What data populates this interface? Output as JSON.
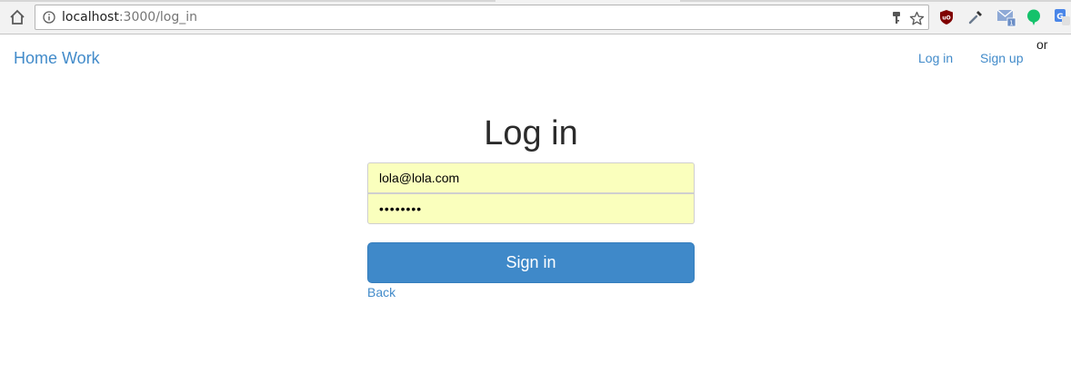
{
  "browser": {
    "url_host": "localhost",
    "url_path": ":3000/log_in",
    "icons": [
      "home-icon",
      "info-icon",
      "key-icon",
      "star-icon",
      "ublock-icon",
      "eyedropper-icon",
      "mail-icon",
      "green-circle-icon",
      "translate-icon"
    ],
    "mail_badge": "1"
  },
  "navbar": {
    "brand": "Home Work",
    "login_label": "Log in",
    "signup_label": "Sign up",
    "or_text": "or"
  },
  "form": {
    "title": "Log in",
    "email_value": "lola@lola.com",
    "password_value": "••••••••",
    "submit_label": "Sign in",
    "back_label": "Back"
  },
  "colors": {
    "link": "#428bca",
    "button": "#3f89c9",
    "autofill": "#faffbd"
  }
}
